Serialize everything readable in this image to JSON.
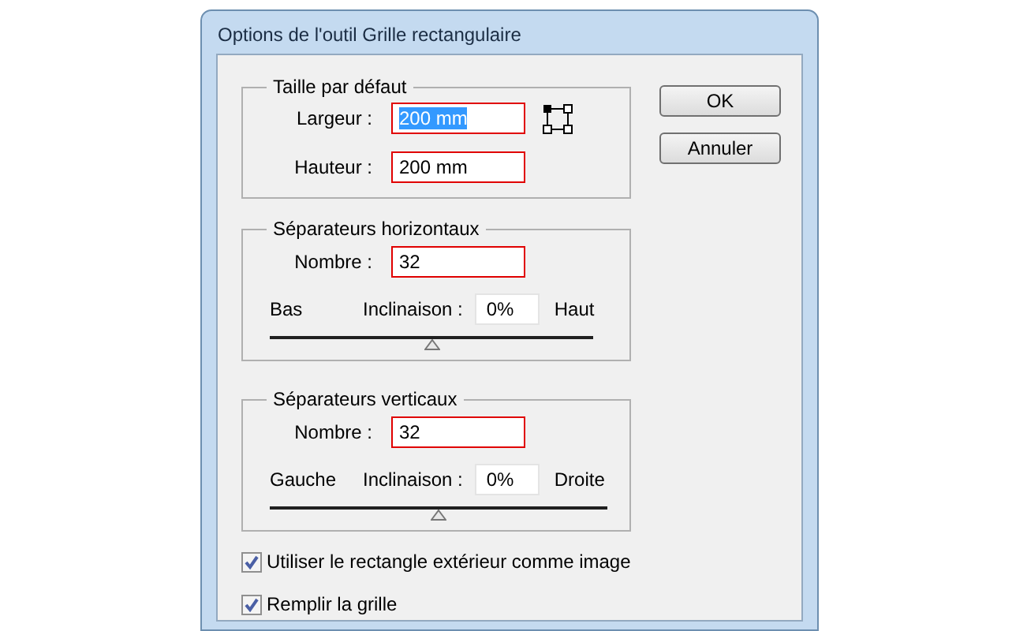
{
  "window": {
    "title": "Options de l'outil Grille rectangulaire"
  },
  "default_size": {
    "legend": "Taille par défaut",
    "fields": [
      {
        "label": "Largeur :",
        "value": "200 mm",
        "text_selected": true
      },
      {
        "label": "Hauteur :",
        "value": "200 mm",
        "text_selected": false
      }
    ]
  },
  "dividers": [
    {
      "legend": "Séparateurs horizontaux",
      "count_label": "Nombre :",
      "count": "32",
      "left": "Bas",
      "skew_label": "Inclinaison :",
      "skew": "0%",
      "right": "Haut",
      "level": 0.5
    },
    {
      "legend": "Séparateurs verticaux",
      "count_label": "Nombre :",
      "count": "32",
      "left": "Gauche",
      "skew_label": "Inclinaison :",
      "skew": "0%",
      "right": "Droite",
      "level": 0.5
    }
  ],
  "checkboxes": [
    {
      "label": "Utiliser le rectangle extérieur comme image",
      "checked": true
    },
    {
      "label": "Remplir la grille",
      "checked": true
    }
  ],
  "buttons": [
    "OK",
    "Annuler"
  ]
}
